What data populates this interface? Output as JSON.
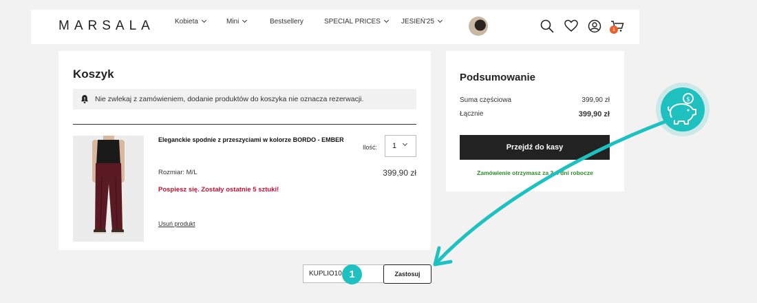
{
  "header": {
    "logo": "MARSALA",
    "nav": [
      {
        "label": "Kobieta",
        "has_dropdown": true
      },
      {
        "label": "Mini",
        "has_dropdown": true
      },
      {
        "label": "Bestsellery",
        "has_dropdown": false
      },
      {
        "label": "SPECIAL PRICES",
        "has_dropdown": true
      },
      {
        "label": "JESIEŃ'25",
        "has_dropdown": true
      }
    ],
    "cart_count": "1"
  },
  "cart": {
    "title": "Koszyk",
    "notice": "Nie zwlekaj z zamówieniem, dodanie produktów do koszyka nie oznacza rezerwacji.",
    "item": {
      "name": "Eleganckie spodnie z przeszyciami w kolorze BORDO - EMBER",
      "qty_label": "Ilość:",
      "qty": "1",
      "size_label": "Rozmiar:  M/L",
      "price": "399,90 zł",
      "warning": "Pospiesz się. Zostały ostatnie 5 sztuki!",
      "remove_label": "Usuń produkt"
    }
  },
  "summary": {
    "title": "Podsumowanie",
    "subtotal_label": "Suma częściowa",
    "subtotal_value": "399,90 zł",
    "total_label": "Łącznie",
    "total_value": "399,90 zł",
    "checkout_label": "Przejdź do kasy",
    "delivery": "Zamówienie otrzymasz za 2-4 dni robocze"
  },
  "coupon": {
    "value": "KUPLIO10",
    "apply_label": "Zastosuj"
  },
  "annotation": {
    "step": "1",
    "accent_color": "#1ec0c0"
  },
  "colors": {
    "warning": "#c8102e",
    "delivery": "#2a8a2a",
    "button": "#222222",
    "cart_badge": "#e8622a"
  }
}
